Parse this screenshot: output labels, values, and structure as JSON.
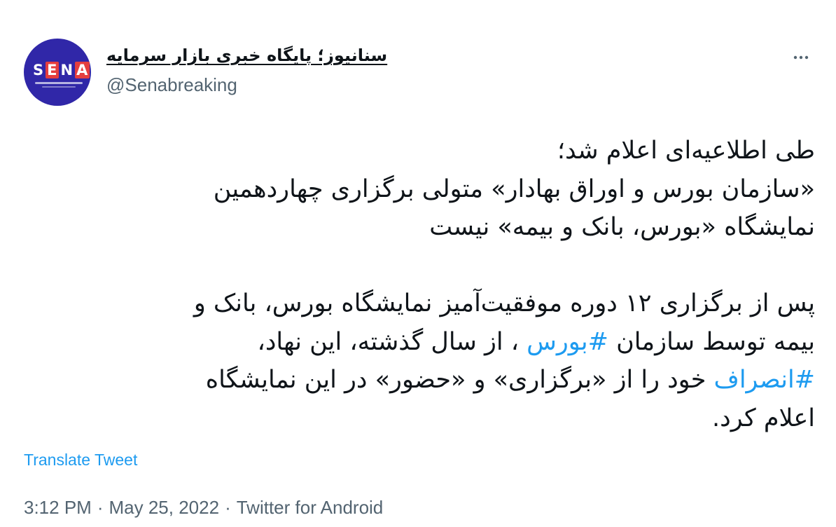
{
  "author": {
    "display_name": "سنانیوز؛ پایگاه خبری بازار سرمایه",
    "handle": "@Senabreaking",
    "avatar_logo_text": "SENA"
  },
  "icons": {
    "more": "more-horizontal-icon",
    "avatar": "sena-logo"
  },
  "tweet": {
    "line1": "طی اطلاعیه‌ای اعلام شد؛",
    "line2": "«سازمان بورس و اوراق بهادار» متولی برگزاری چهاردهمین",
    "line3": "نمایشگاه «بورس، بانک و بیمه» نیست",
    "line4": "پس از برگزاری ۱۲ دوره موفقیت‌آمیز نمایشگاه بورس، بانک و",
    "line5_before": "بیمه توسط سازمان ",
    "hashtag1": "#بورس",
    "line5_after": " ، از سال گذشته، این نهاد،",
    "hashtag2": "#انصراف",
    "line6_after": " خود را از «برگزاری» و «حضور» در این نمایشگاه",
    "line7": "اعلام کرد."
  },
  "translate_label": "Translate Tweet",
  "meta": {
    "time": "3:12 PM",
    "separator": "·",
    "date": "May 25, 2022",
    "source": "Twitter for Android"
  },
  "colors": {
    "link": "#1d9bf0",
    "secondary_text": "#536471",
    "primary_text": "#0f1419",
    "avatar_bg": "#3027a8",
    "logo_red": "#e53e3e"
  }
}
